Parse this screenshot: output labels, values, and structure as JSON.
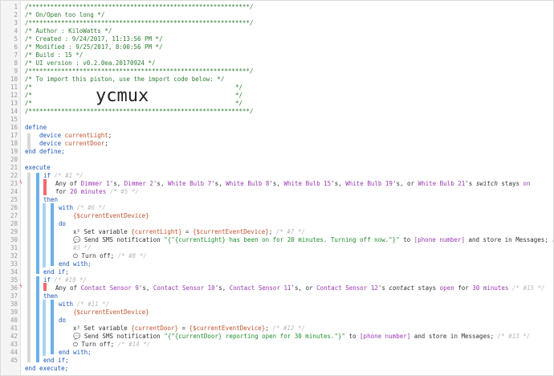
{
  "line_numbers": [
    "1",
    "2",
    "3",
    "4",
    "5",
    "6",
    "7",
    "8",
    "9",
    "10",
    "11",
    "12",
    "13",
    "14",
    "15",
    "16",
    "17",
    "18",
    "19",
    "20",
    "21",
    "22",
    "23",
    "24",
    "25",
    "26",
    "27",
    "28",
    "29",
    "30",
    "31",
    "32",
    "33",
    "34",
    "35",
    "36",
    "37",
    "38",
    "39",
    "40",
    "41",
    "42",
    "43",
    "44",
    "45"
  ],
  "header": {
    "border": "/*************************************************************/",
    "title": "/* On/Open too long                                         */",
    "author": "/* Author     : KiloWatts                                    */",
    "created": "/* Created    : 9/24/2017, 11:13:56 PM                       */",
    "modified": "/* Modified   : 9/25/2017, 8:00:56 PM                        */",
    "build": "/* Build      : 15                                           */",
    "ui_version": "/* UI version : v0.2.0ea.20170924                           */",
    "import_line": "/* To import this piston, use the import code below:        */",
    "blank_open": "/*",
    "blank_close": "*/",
    "import_code": "ycmux"
  },
  "code": {
    "define": "define",
    "device": "device",
    "current_light": "currentLight",
    "current_door": "currentDoor",
    "semicolon": ";",
    "end_define": "end define;",
    "execute": "execute",
    "if": "if",
    "if1_comment": "/* #1 */",
    "any_of": "Any of",
    "dimmer1": "Dimmer 1",
    "dimmer2": "Dimmer 2",
    "white_bulb7": "White Bulb 7",
    "white_bulb8": "White Bulb 8",
    "white_bulb15": "White Bulb 15",
    "white_bulb19": "White Bulb 19",
    "white_bulb21": "White Bulb 21",
    "poss_comma": "'s, ",
    "poss_or": "'s, or ",
    "poss": "'s ",
    "switch_attr": "switch",
    "stays": " stays ",
    "on_value": "on",
    "for_word": "for ",
    "twenty_minutes": "20 minutes",
    "if5_comment": "/* #5 */",
    "then": "then",
    "with": "with",
    "with6_comment": "/* #6 */",
    "current_event_device": "{$currentEventDevice}",
    "do": "do",
    "set_variable": "x² Set variable ",
    "current_light_paren": "{currentLight}",
    "equals": " = ",
    "set7_comment": "/* #7 */",
    "sms_icon": "💬",
    "send_sms": " Send SMS notification ",
    "sms1_text": "\"{\"{currentLight} has been on for 20 minutes. Turning off now.\"}\"",
    "to_word": " to ",
    "phone_number": "[phone number]",
    "store_messages": " and store in Messages;",
    "sms3_comment": "/*",
    "sms3_cont": "#3 */",
    "power_icon": "⏻",
    "turn_off": " Turn off;",
    "turn8_comment": "/* #8 */",
    "end_with": "end with;",
    "end_if": "end if;",
    "if10_comment": "/* #10 */",
    "contact_sensor9": "Contact Sensor 9",
    "contact_sensor10": "Contact Sensor 10",
    "contact_sensor11": "Contact Sensor 11",
    "contact_sensor12": "Contact Sensor 12",
    "contact_attr": "contact",
    "open_value": "open",
    "for_30": " for ",
    "thirty_minutes": "30 minutes",
    "if15_comment": "/* #15 */",
    "with11_comment": "/* #11 */",
    "current_door_paren": "{currentDoor}",
    "set12_comment": "/* #12 */",
    "sms2_text": "\"{\"{currentDoor} reporting open for 30 minutes.\"}\"",
    "sms13_comment": "/* #13 */",
    "turn14_comment": "/* #14 */",
    "end_execute": "end execute;"
  }
}
